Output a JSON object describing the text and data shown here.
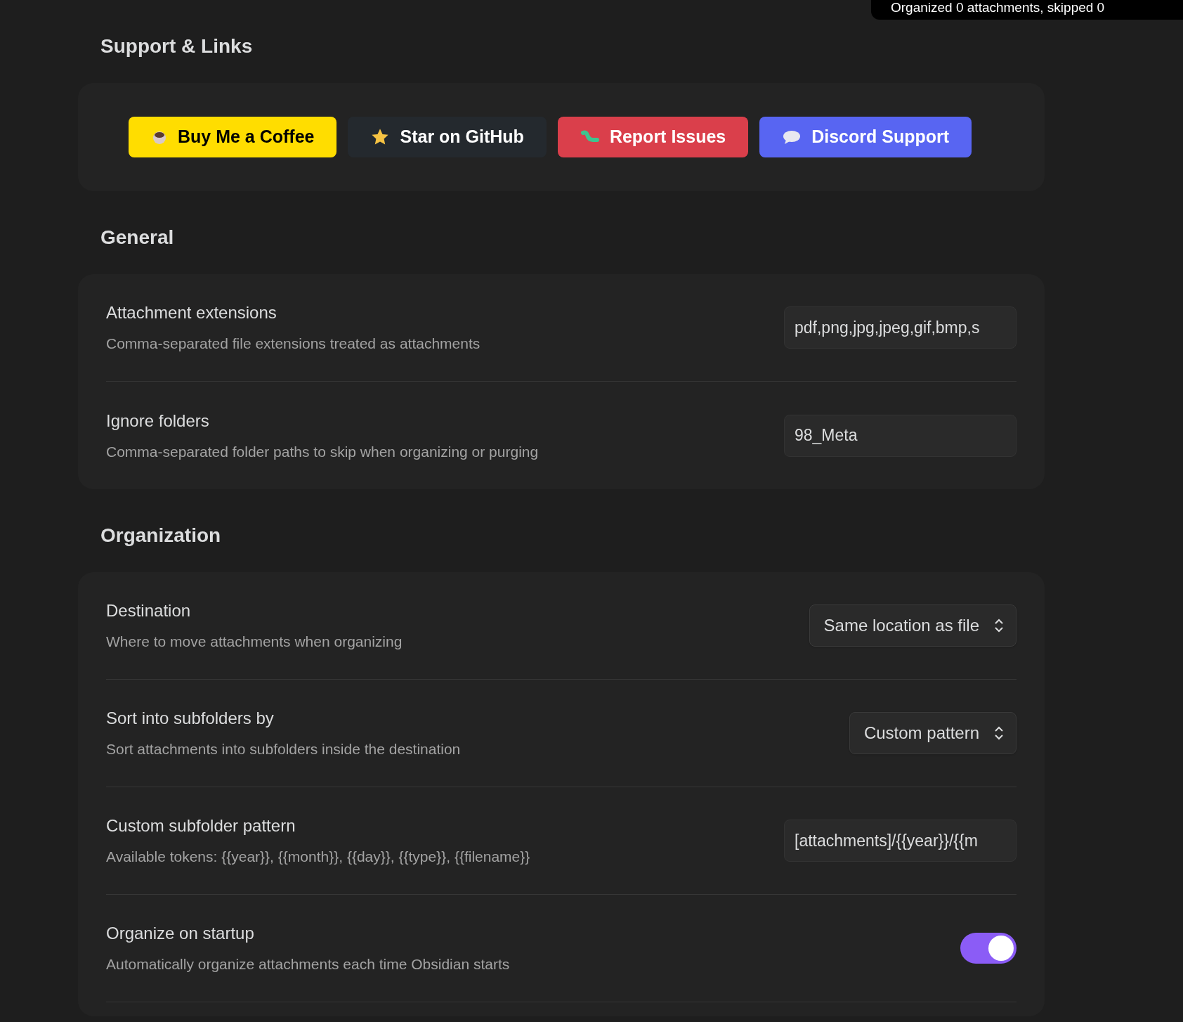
{
  "toast": {
    "text": "Organized 0 attachments, skipped 0"
  },
  "sections": [
    {
      "title": "Support & Links",
      "kind": "links",
      "buttons": [
        {
          "label": "Buy Me a Coffee",
          "kind": "coffee"
        },
        {
          "label": "Star on GitHub",
          "kind": "github"
        },
        {
          "label": "Report Issues",
          "kind": "issues"
        },
        {
          "label": "Discord Support",
          "kind": "discord"
        }
      ]
    },
    {
      "title": "General",
      "kind": "settings",
      "settings": [
        {
          "name": "Attachment extensions",
          "description": "Comma-separated file extensions treated as attachments",
          "kind": "text",
          "value": "pdf,png,jpg,jpeg,gif,bmp,s"
        },
        {
          "name": "Ignore folders",
          "description": "Comma-separated folder paths to skip when organizing or purging",
          "kind": "text",
          "value": "98_Meta"
        }
      ]
    },
    {
      "title": "Organization",
      "kind": "settings",
      "settings": [
        {
          "name": "Destination",
          "description": "Where to move attachments when organizing",
          "kind": "dropdown",
          "value": "Same location as file"
        },
        {
          "name": "Sort into subfolders by",
          "description": "Sort attachments into subfolders inside the destination",
          "kind": "dropdown",
          "value": "Custom pattern"
        },
        {
          "name": "Custom subfolder pattern",
          "description": "Available tokens: {{year}}, {{month}}, {{day}}, {{type}}, {{filename}}",
          "kind": "text",
          "value": "[attachments]/{{year}}/{{m"
        },
        {
          "name": "Organize on startup",
          "description": "Automatically organize attachments each time Obsidian starts",
          "kind": "toggle",
          "on": true
        }
      ]
    }
  ]
}
